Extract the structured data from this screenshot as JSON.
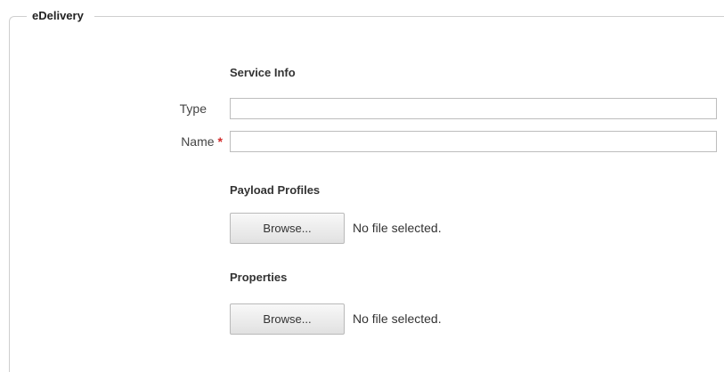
{
  "fieldset": {
    "legend": "eDelivery"
  },
  "service_info": {
    "title": "Service Info",
    "type_label": "Type",
    "type_value": "",
    "name_label": "Name",
    "name_required_mark": "*",
    "name_value": ""
  },
  "payload_profiles": {
    "title": "Payload Profiles",
    "browse_label": "Browse...",
    "status": "No file selected."
  },
  "properties": {
    "title": "Properties",
    "browse_label": "Browse...",
    "status": "No file selected."
  },
  "colors": {
    "required": "#d22b2b",
    "border": "#cfcfcf"
  }
}
